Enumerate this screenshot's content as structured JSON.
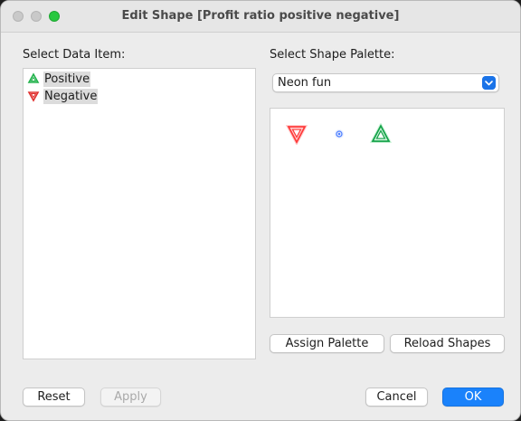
{
  "window": {
    "title": "Edit Shape [Profit ratio positive negative]"
  },
  "data_item": {
    "label": "Select Data Item:",
    "items": [
      {
        "label": "Positive",
        "icon": "green-triangle-up-icon",
        "color": "#21b24b"
      },
      {
        "label": "Negative",
        "icon": "red-triangle-down-icon",
        "color": "#e0302e"
      }
    ]
  },
  "palette": {
    "label": "Select Shape Palette:",
    "selected": "Neon fun",
    "shapes": [
      {
        "icon": "neon-red-triangle-down-icon",
        "color": "#ff3b3b"
      },
      {
        "icon": "neon-blue-circle-icon",
        "color": "#4a7dff"
      },
      {
        "icon": "neon-green-triangle-up-icon",
        "color": "#22c55e"
      }
    ]
  },
  "buttons": {
    "assign_palette": "Assign Palette",
    "reload_shapes": "Reload Shapes",
    "reset": "Reset",
    "apply": "Apply",
    "cancel": "Cancel",
    "ok": "OK"
  },
  "colors": {
    "accent": "#1a82fb",
    "window_bg": "#ececec"
  }
}
